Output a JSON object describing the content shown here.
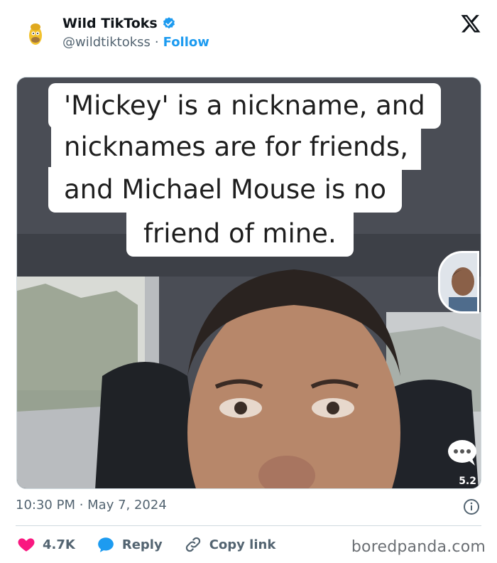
{
  "tweet": {
    "author_name": "Wild TikToks",
    "author_handle": "@wildtiktokss",
    "separator": "·",
    "follow_label": "Follow",
    "timestamp": "10:30 PM · May 7, 2024"
  },
  "media": {
    "caption_lines": [
      "'Mickey' is a nickname, and",
      "nicknames are for friends,",
      "and Michael Mouse is no",
      "friend of mine."
    ],
    "comment_count_partial": "5.2"
  },
  "actions": {
    "like_count": "4.7K",
    "reply_label": "Reply",
    "copy_link_label": "Copy link"
  },
  "watermark": "boredpanda.com",
  "colors": {
    "accent": "#1d9bf0",
    "like": "#f91880",
    "text_secondary": "#536471",
    "divider": "#cfd9de"
  },
  "icons": [
    "verified-badge-icon",
    "x-logo-icon",
    "info-icon",
    "heart-icon",
    "reply-bubble-icon",
    "link-icon",
    "chat-bubble-icon"
  ]
}
